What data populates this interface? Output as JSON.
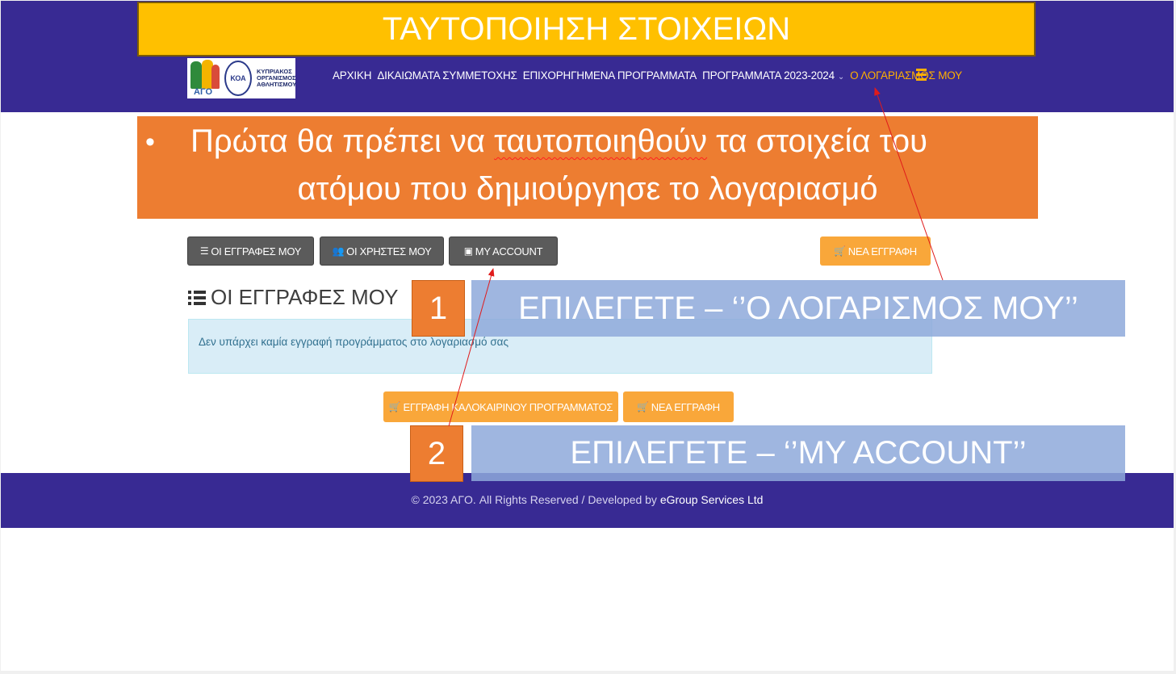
{
  "slide_title": "ΤΑΥΤΟΠΟΙΗΣΗ ΣΤΟΙΧΕΙΩΝ",
  "logo": {
    "ago_text": "ΑΓΟ",
    "koa_initials": "ΚΟΑ",
    "koa_text": "ΚΥΠΡΙΑΚΟΣ ΟΡΓΑΝΙΣΜΟΣ ΑΘΛΗΤΙΣΜΟΥ"
  },
  "nav": {
    "items": [
      "ΑΡΧΙΚΗ",
      "ΔΙΚΑΙΩΜΑΤΑ ΣΥΜΜΕΤΟΧΗΣ",
      "ΕΠΙΧΟΡΗΓΗΜΕΝΑ ΠΡΟΓΡΑΜΜΑΤΑ",
      "ΠΡΟΓΡΑΜΜΑΤΑ 2023-2024",
      "Ο ΛΟΓΑΡΙΑΣΜΟΣ ΜΟΥ"
    ],
    "dropdown_caret": "⌄"
  },
  "callout": {
    "bullet": "•",
    "line1_a": "Πρώτα θα πρέπει να ",
    "line1_b": "ταυτοποιηθούν",
    "line1_c": " τα στοιχεία του",
    "line2": "ατόμου που δημιούργησε το λογαριασμό"
  },
  "buttons": {
    "my_registrations": "ΟΙ ΕΓΓΡΑΦΕΣ ΜΟΥ",
    "my_users": "ΟΙ ΧΡΗΣΤΕΣ ΜΟΥ",
    "my_account": "MY ACCOUNT",
    "new_registration_top": "ΝΕΑ ΕΓΓΡΑΦΗ",
    "summer_registration": "ΕΓΓΡΑΦΗ ΚΑΛΟΚΑΙΡΙΝΟΥ ΠΡΟΓΡΑΜΜΑΤΟΣ",
    "new_registration_bottom": "ΝΕΑ ΕΓΓΡΑΦΗ"
  },
  "section_title": "ΟΙ ΕΓΓΡΑΦΕΣ ΜΟΥ",
  "info_message": "Δεν υπάρχει καμία εγγραφή προγράμματος στο λογαριασμό σας",
  "steps": [
    {
      "number": "1",
      "text": "ΕΠΙΛΕΓΕΤΕ – ‘’Ο ΛΟΓΑΡΙΣΜΟΣ ΜΟΥ’’"
    },
    {
      "number": "2",
      "text": "ΕΠΙΛΕΓΕΤΕ – ‘’MY ACCOUNT’’"
    }
  ],
  "footer": {
    "text": "© 2023 ΑΓΟ. All Rights Reserved / Developed by ",
    "developer": "eGroup Services Ltd"
  },
  "colors": {
    "header_purple": "#382a93",
    "title_yellow": "#ffc000",
    "callout_orange": "#ed7d31",
    "active_nav": "#ffb000",
    "button_amber": "#f9a73a",
    "button_dark": "#5b5b5b",
    "step_blue": "#8ea9db",
    "arrow_red": "#e01b1b"
  },
  "icons": {
    "list": "list-icon",
    "users": "users-icon",
    "id_card": "id-card-icon",
    "cart": "cart-icon",
    "hamburger": "hamburger-menu-icon"
  }
}
